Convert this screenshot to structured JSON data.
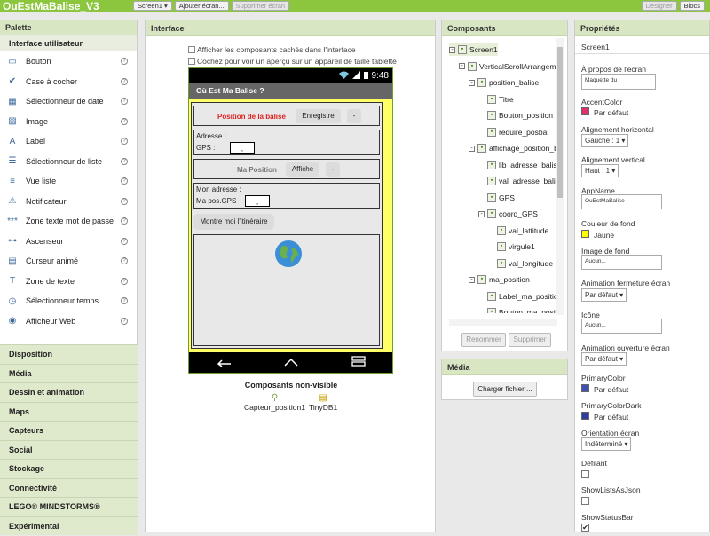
{
  "topbar": {
    "title": "OuEstMaBalise_V3",
    "screen_btn": "Screen1 ▾",
    "add_screen": "Ajouter écran...",
    "remove_screen": "Supprimer écran",
    "designer": "Designer",
    "blocks": "Blocs"
  },
  "palette": {
    "header": "Palette",
    "sub": "Interface utilisateur",
    "items": [
      {
        "label": "Bouton",
        "icon": "▭"
      },
      {
        "label": "Case à cocher",
        "icon": "✔"
      },
      {
        "label": "Sélectionneur de date",
        "icon": "▦"
      },
      {
        "label": "Image",
        "icon": "▨"
      },
      {
        "label": "Label",
        "icon": "A"
      },
      {
        "label": "Sélectionneur de liste",
        "icon": "☰"
      },
      {
        "label": "Vue liste",
        "icon": "≡"
      },
      {
        "label": "Notificateur",
        "icon": "⚠"
      },
      {
        "label": "Zone texte mot de passe",
        "icon": "***"
      },
      {
        "label": "Ascenseur",
        "icon": "⊶"
      },
      {
        "label": "Curseur animé",
        "icon": "▤"
      },
      {
        "label": "Zone de texte",
        "icon": "T"
      },
      {
        "label": "Sélectionneur temps",
        "icon": "◷"
      },
      {
        "label": "Afficheur Web",
        "icon": "◉"
      }
    ],
    "categories": [
      "Disposition",
      "Média",
      "Dessin et animation",
      "Maps",
      "Capteurs",
      "Social",
      "Stockage",
      "Connectivité",
      "LEGO® MINDSTORMS®",
      "Expérimental"
    ]
  },
  "interface": {
    "header": "Interface",
    "show_hidden": "Afficher les composants cachés dans l'interface",
    "tablet": "Cochez pour voir un aperçu sur un appareil de taille tablette",
    "time": "9:48",
    "app_title": "Où Est Ma Balise ?",
    "pos_balise": "Position de la balise",
    "enregistre": "Enregistre",
    "dash1": "-",
    "adresse": "Adresse :",
    "gps": "GPS :",
    "comma1": ",",
    "ma_position": "Ma Position",
    "affiche": "Affiche",
    "dash2": "-",
    "mon_adresse": "Mon adresse :",
    "ma_pos_gps": "Ma pos.GPS",
    "comma2": ",",
    "montre": "Montre moi l'itinéraire",
    "nonvisible_title": "Composants non-visible",
    "nonvisible": [
      "Capteur_position1",
      "TinyDB1"
    ]
  },
  "components": {
    "header": "Composants",
    "tree": [
      {
        "label": "Screen1",
        "depth": 0,
        "expand": "⊟"
      },
      {
        "label": "VerticalScrollArrangement1",
        "depth": 1,
        "expand": "⊟"
      },
      {
        "label": "position_balise",
        "depth": 2,
        "expand": "⊟"
      },
      {
        "label": "Titre",
        "depth": 3,
        "expand": ""
      },
      {
        "label": "Bouton_position",
        "depth": 3,
        "expand": ""
      },
      {
        "label": "reduire_posbal",
        "depth": 3,
        "expand": ""
      },
      {
        "label": "affichage_position_balise",
        "depth": 2,
        "expand": "⊟"
      },
      {
        "label": "lib_adresse_balise",
        "depth": 3,
        "expand": ""
      },
      {
        "label": "val_adresse_balise",
        "depth": 3,
        "expand": ""
      },
      {
        "label": "GPS",
        "depth": 3,
        "expand": ""
      },
      {
        "label": "coord_GPS",
        "depth": 3,
        "expand": "⊟"
      },
      {
        "label": "val_lattitude",
        "depth": 4,
        "expand": ""
      },
      {
        "label": "virgule1",
        "depth": 4,
        "expand": ""
      },
      {
        "label": "val_longitude",
        "depth": 4,
        "expand": ""
      },
      {
        "label": "ma_position",
        "depth": 2,
        "expand": "⊟"
      },
      {
        "label": "Label_ma_position",
        "depth": 3,
        "expand": ""
      },
      {
        "label": "Bouton_ma_position",
        "depth": 3,
        "expand": ""
      }
    ],
    "rename": "Renommer",
    "delete": "Supprimer"
  },
  "media": {
    "header": "Média",
    "upload": "Charger fichier ..."
  },
  "properties": {
    "header": "Propriétés",
    "screen": "Screen1",
    "about_label": "À propos de l'écran",
    "about_value": "Maquette du",
    "accent_label": "AccentColor",
    "accent_value": "Par défaut",
    "accent_color": "#e0306a",
    "halign_label": "Alignement horizontal",
    "halign_value": "Gauche : 1 ▾",
    "valign_label": "Alignement vertical",
    "valign_value": "Haut : 1 ▾",
    "appname_label": "AppName",
    "appname_value": "OuEstMaBalise",
    "bg_label": "Couleur de fond",
    "bg_value": "Jaune",
    "bg_color": "#ffff00",
    "bgimg_label": "Image de fond",
    "bgimg_value": "Aucun...",
    "closeanim_label": "Animation fermeture écran",
    "closeanim_value": "Par défaut ▾",
    "icon_label": "Icône",
    "icon_value": "Aucun...",
    "openanim_label": "Animation ouverture écran",
    "openanim_value": "Par défaut ▾",
    "primary_label": "PrimaryColor",
    "primary_value": "Par défaut",
    "primary_color": "#3f51b5",
    "primarydark_label": "PrimaryColorDark",
    "primarydark_value": "Par défaut",
    "primarydark_color": "#303f9f",
    "orient_label": "Orientation écran",
    "orient_value": "Indéterminé ▾",
    "scroll_label": "Défilant",
    "showlists_label": "ShowListsAsJson",
    "statusbar_label": "ShowStatusBar",
    "check": "✔"
  }
}
